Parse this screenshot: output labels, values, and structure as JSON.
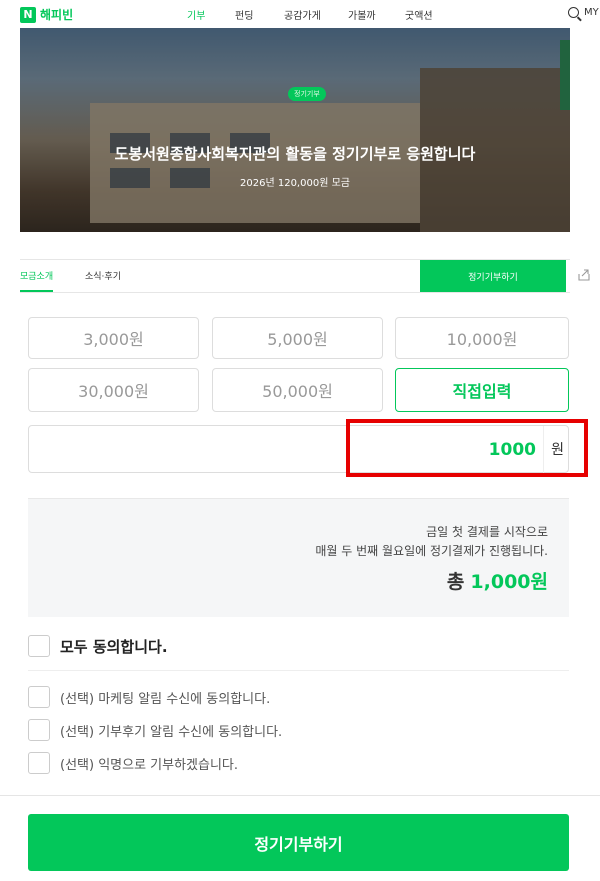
{
  "header": {
    "logo_mark": "N",
    "logo_text": "해피빈",
    "nav": [
      "기부",
      "펀딩",
      "공감가게",
      "가볼까",
      "굿액션"
    ],
    "my": "MY"
  },
  "hero": {
    "badge": "정기기부",
    "title": "도봉서원종합사회복지관의 활동을 정기기부로 응원합니다",
    "subtitle": "2026년 120,000원 모금"
  },
  "tabs": {
    "items": [
      "모금소개",
      "소식·후기"
    ],
    "donate_button": "정기기부하기"
  },
  "amounts": {
    "options": [
      "3,000원",
      "5,000원",
      "10,000원",
      "30,000원",
      "50,000원"
    ],
    "custom_label": "직접입력",
    "custom_value": "1000",
    "unit": "원"
  },
  "summary": {
    "line1": "금일 첫 결제를 시작으로",
    "line2": "매월 두 번째 월요일에 정기결제가 진행됩니다.",
    "total_label": "총",
    "total_value": "1,000원"
  },
  "agreements": {
    "all": "모두 동의합니다.",
    "options": [
      "(선택) 마케팅 알림 수신에 동의합니다.",
      "(선택) 기부후기 알림 수신에 동의합니다.",
      "(선택) 익명으로 기부하겠습니다."
    ]
  },
  "submit_label": "정기기부하기",
  "colors": {
    "brand": "#03c75a",
    "highlight": "#e60000"
  }
}
